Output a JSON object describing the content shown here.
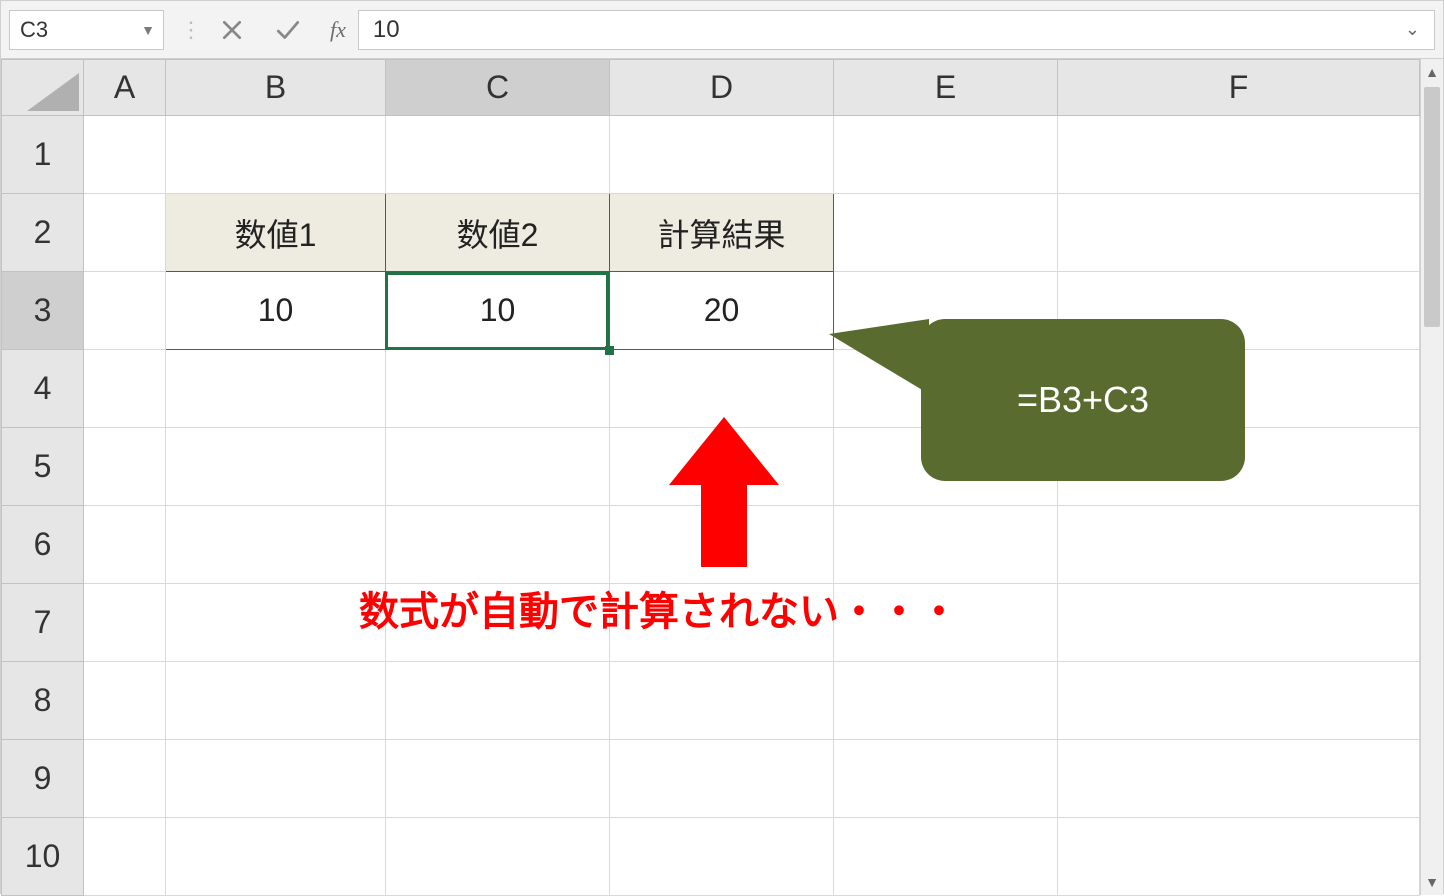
{
  "formula_bar": {
    "name_box_value": "C3",
    "formula_value": "10",
    "fx_label": "fx"
  },
  "columns": [
    "A",
    "B",
    "C",
    "D",
    "E",
    "F"
  ],
  "rows": [
    "1",
    "2",
    "3",
    "4",
    "5",
    "6",
    "7",
    "8",
    "9",
    "10"
  ],
  "active": {
    "col": "C",
    "row": "3"
  },
  "data_table": {
    "headers": {
      "b2": "数値1",
      "c2": "数値2",
      "d2": "計算結果"
    },
    "values": {
      "b3": "10",
      "c3": "10",
      "d3": "20"
    }
  },
  "callout_text": "=B3+C3",
  "annotation_text": "数式が自動で計算されない・・・",
  "icons": {
    "cancel": "cancel-icon",
    "enter": "enter-icon",
    "fx": "fx-icon",
    "dropdown": "chevron-down-icon",
    "expand": "chevron-down-icon",
    "scroll_up": "chevron-up-icon",
    "scroll_down": "chevron-down-icon",
    "arrow_up": "arrow-up-icon"
  }
}
